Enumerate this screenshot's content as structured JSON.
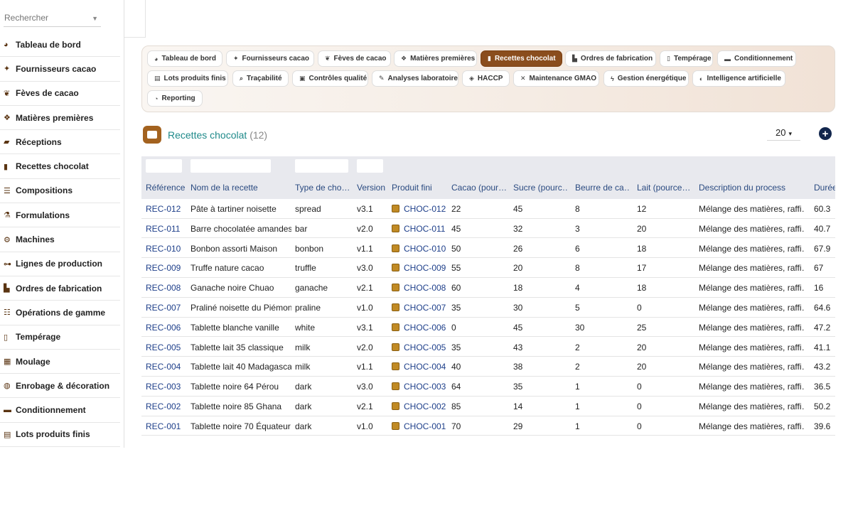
{
  "search": {
    "placeholder": "Rechercher"
  },
  "sidebar": {
    "items": [
      {
        "label": "Tableau de bord",
        "icon": "palette-icon",
        "glyph": "◕"
      },
      {
        "label": "Fournisseurs cacao",
        "icon": "handshake-icon",
        "glyph": "✦"
      },
      {
        "label": "Fèves de cacao",
        "icon": "seedling-icon",
        "glyph": "❦"
      },
      {
        "label": "Matières premières",
        "icon": "cubes-icon",
        "glyph": "❖"
      },
      {
        "label": "Réceptions",
        "icon": "truck-loading-icon",
        "glyph": "▰"
      },
      {
        "label": "Recettes chocolat",
        "icon": "book-open-icon",
        "glyph": "▮"
      },
      {
        "label": "Compositions",
        "icon": "list-icon",
        "glyph": "☰"
      },
      {
        "label": "Formulations",
        "icon": "flask-icon",
        "glyph": "⚗"
      },
      {
        "label": "Machines",
        "icon": "cogs-icon",
        "glyph": "⚙"
      },
      {
        "label": "Lignes de production",
        "icon": "project-diagram-icon",
        "glyph": "⊶"
      },
      {
        "label": "Ordres de fabrication",
        "icon": "industry-icon",
        "glyph": "▙"
      },
      {
        "label": "Opérations de gamme",
        "icon": "tasks-icon",
        "glyph": "☷"
      },
      {
        "label": "Tempérage",
        "icon": "thermometer-icon",
        "glyph": "▯"
      },
      {
        "label": "Moulage",
        "icon": "th-large-icon",
        "glyph": "▦"
      },
      {
        "label": "Enrobage & décoration",
        "icon": "cookie-bite-icon",
        "glyph": "◍"
      },
      {
        "label": "Conditionnement",
        "icon": "box-icon",
        "glyph": "▬"
      },
      {
        "label": "Lots produits finis",
        "icon": "pallet-icon",
        "glyph": "▤"
      }
    ]
  },
  "module_nav": {
    "chips": [
      {
        "label": "Tableau de bord",
        "icon": "palette-icon",
        "glyph": "◕",
        "active": false
      },
      {
        "label": "Fournisseurs cacao",
        "icon": "handshake-icon",
        "glyph": "✦",
        "active": false
      },
      {
        "label": "Fèves de cacao",
        "icon": "seedling-icon",
        "glyph": "❦",
        "active": false
      },
      {
        "label": "Matières premières",
        "icon": "cubes-icon",
        "glyph": "❖",
        "active": false
      },
      {
        "label": "Recettes chocolat",
        "icon": "book-open-icon",
        "glyph": "▮",
        "active": true
      },
      {
        "label": "Ordres de fabrication",
        "icon": "industry-icon",
        "glyph": "▙",
        "active": false
      },
      {
        "label": "Tempérage",
        "icon": "thermometer-icon",
        "glyph": "▯",
        "active": false
      },
      {
        "label": "Conditionnement",
        "icon": "box-icon",
        "glyph": "▬",
        "active": false
      },
      {
        "label": "Lots produits finis",
        "icon": "pallet-icon",
        "glyph": "▤",
        "active": false
      },
      {
        "label": "Traçabilité",
        "icon": "search-icon",
        "glyph": "⌕",
        "active": false
      },
      {
        "label": "Contrôles qualité",
        "icon": "clipboard-check-icon",
        "glyph": "▣",
        "active": false
      },
      {
        "label": "Analyses laboratoire",
        "icon": "microscope-icon",
        "glyph": "✎",
        "active": false
      },
      {
        "label": "HACCP",
        "icon": "shield-icon",
        "glyph": "◈",
        "active": false
      },
      {
        "label": "Maintenance GMAO",
        "icon": "tools-icon",
        "glyph": "✕",
        "active": false
      },
      {
        "label": "Gestion énergétique",
        "icon": "bolt-icon",
        "glyph": "ϟ",
        "active": false
      },
      {
        "label": "Intelligence artificielle",
        "icon": "brain-icon",
        "glyph": "◐",
        "active": false
      },
      {
        "label": "Reporting",
        "icon": "chart-pie-icon",
        "glyph": "◔",
        "active": false
      }
    ]
  },
  "header": {
    "title": "Recettes chocolat",
    "count": "(12)",
    "per_page": "20",
    "add_symbol": "+"
  },
  "table": {
    "columns": [
      "Référence",
      "Nom de la recette",
      "Type de cho…",
      "Version",
      "Produit fini",
      "Cacao (pour…",
      "Sucre (pourc…",
      "Beurre de ca…",
      "Lait (pource…",
      "Description du process",
      "Durée"
    ],
    "rows": [
      [
        "REC-012",
        "Pâte à tartiner noisette",
        "spread",
        "v3.1",
        "CHOC-012",
        "22",
        "45",
        "8",
        "12",
        "Mélange des matières, raffi…",
        "60.3"
      ],
      [
        "REC-011",
        "Barre chocolatée amandes",
        "bar",
        "v2.0",
        "CHOC-011",
        "45",
        "32",
        "3",
        "20",
        "Mélange des matières, raffi…",
        "40.7"
      ],
      [
        "REC-010",
        "Bonbon assorti Maison",
        "bonbon",
        "v1.1",
        "CHOC-010",
        "50",
        "26",
        "6",
        "18",
        "Mélange des matières, raffi…",
        "67.9"
      ],
      [
        "REC-009",
        "Truffe nature cacao",
        "truffle",
        "v3.0",
        "CHOC-009",
        "55",
        "20",
        "8",
        "17",
        "Mélange des matières, raffi…",
        "67"
      ],
      [
        "REC-008",
        "Ganache noire Chuao",
        "ganache",
        "v2.1",
        "CHOC-008",
        "60",
        "18",
        "4",
        "18",
        "Mélange des matières, raffi…",
        "16"
      ],
      [
        "REC-007",
        "Praliné noisette du Piémont",
        "praline",
        "v1.0",
        "CHOC-007",
        "35",
        "30",
        "5",
        "0",
        "Mélange des matières, raffi…",
        "64.6"
      ],
      [
        "REC-006",
        "Tablette blanche vanille",
        "white",
        "v3.1",
        "CHOC-006",
        "0",
        "45",
        "30",
        "25",
        "Mélange des matières, raffi…",
        "47.2"
      ],
      [
        "REC-005",
        "Tablette lait 35 classique",
        "milk",
        "v2.0",
        "CHOC-005",
        "35",
        "43",
        "2",
        "20",
        "Mélange des matières, raffi…",
        "41.1"
      ],
      [
        "REC-004",
        "Tablette lait 40 Madagascar",
        "milk",
        "v1.1",
        "CHOC-004",
        "40",
        "38",
        "2",
        "20",
        "Mélange des matières, raffi…",
        "43.2"
      ],
      [
        "REC-003",
        "Tablette noire 64 Pérou",
        "dark",
        "v3.0",
        "CHOC-003",
        "64",
        "35",
        "1",
        "0",
        "Mélange des matières, raffi…",
        "36.5"
      ],
      [
        "REC-002",
        "Tablette noire 85 Ghana",
        "dark",
        "v2.1",
        "CHOC-002",
        "85",
        "14",
        "1",
        "0",
        "Mélange des matières, raffi…",
        "50.2"
      ],
      [
        "REC-001",
        "Tablette noire 70 Équateur",
        "dark",
        "v1.0",
        "CHOC-001",
        "70",
        "29",
        "1",
        "0",
        "Mélange des matières, raffi…",
        "39.6"
      ]
    ]
  },
  "colors": {
    "accent": "#8a4d1d",
    "link": "#1e3f8a",
    "title": "#1f8a8a",
    "add": "#12264d",
    "header_bg": "#e8e9ee"
  }
}
